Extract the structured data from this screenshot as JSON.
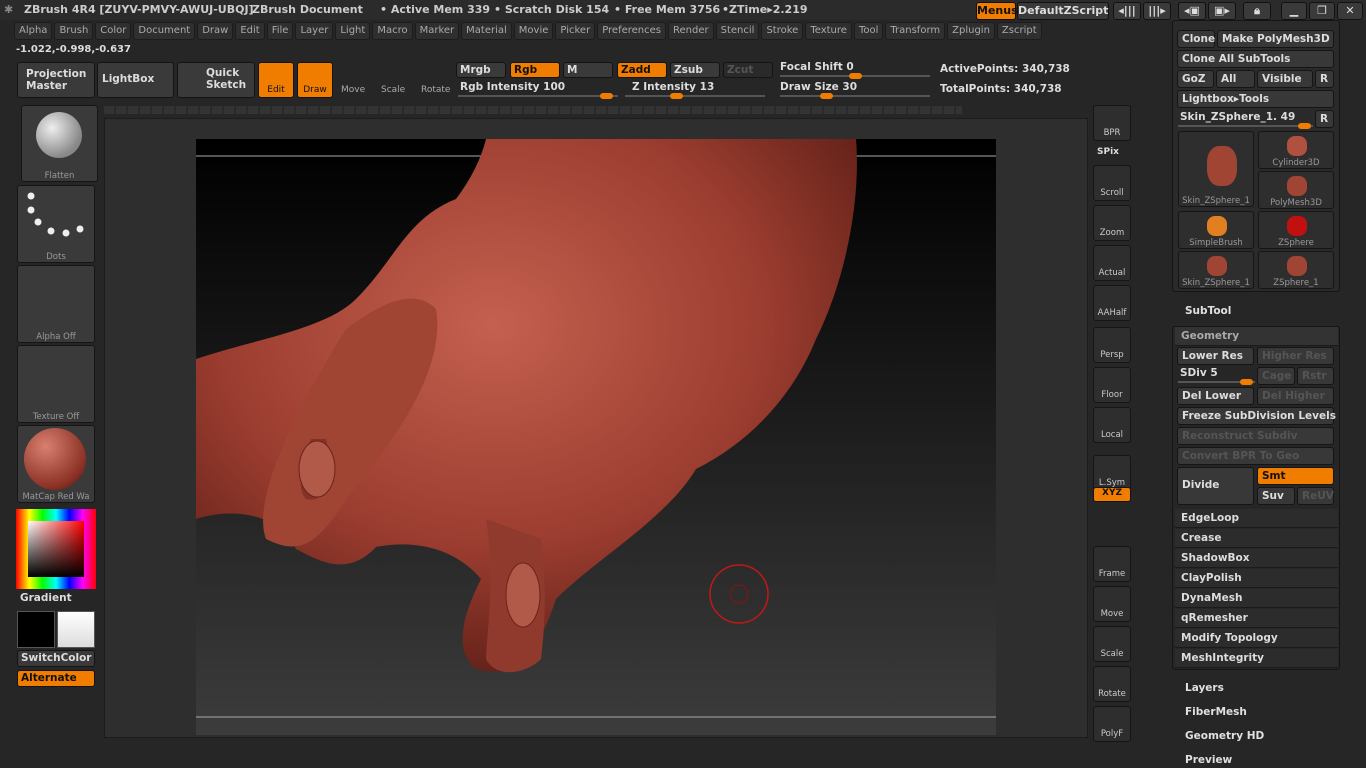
{
  "title": {
    "app": "ZBrush 4R4 [ZUYV-PMVY-AWUJ-UBQJ]",
    "doc": "ZBrush Document",
    "active_mem": "• Active Mem 339",
    "scratch": "• Scratch Disk 154",
    "free_mem": "• Free Mem 3756",
    "ztime": "•ZTime▸2.219",
    "menus": "Menus",
    "defaultzscript": "DefaultZScript"
  },
  "menu": [
    "Alpha",
    "Brush",
    "Color",
    "Document",
    "Draw",
    "Edit",
    "File",
    "Layer",
    "Light",
    "Macro",
    "Marker",
    "Material",
    "Movie",
    "Picker",
    "Preferences",
    "Render",
    "Stencil",
    "Stroke",
    "Texture",
    "Tool",
    "Transform",
    "Zplugin",
    "Zscript"
  ],
  "coords": "-1.022,-0.998,-0.637",
  "toolbar": {
    "projection_master": "Projection Master",
    "lightbox": "LightBox",
    "quick_sketch": "Quick Sketch",
    "edit": "Edit",
    "draw": "Draw",
    "move": "Move",
    "scale": "Scale",
    "rotate": "Rotate",
    "mrgb": "Mrgb",
    "rgb": "Rgb",
    "m": "M",
    "zadd": "Zadd",
    "zsub": "Zsub",
    "zcut": "Zcut",
    "rgb_intensity": "Rgb Intensity 100",
    "z_intensity": "Z Intensity 13",
    "focal_shift": "Focal Shift 0",
    "draw_size": "Draw Size 30",
    "active_points": "ActivePoints: 340,738",
    "total_points": "TotalPoints: 340,738",
    "rgb_intensity_value": 100,
    "z_intensity_value": 13,
    "focal_shift_value": 0,
    "draw_size_value": 30
  },
  "left_shelf": {
    "brush": "Flatten",
    "stroke": "Dots",
    "alpha": "Alpha Off",
    "texture": "Texture Off",
    "material": "MatCap Red Wa",
    "gradient": "Gradient",
    "switchcolor": "SwitchColor",
    "alternate": "Alternate"
  },
  "right_shelf": [
    "BPR",
    "SPix",
    "Scroll",
    "Zoom",
    "Actual",
    "AAHalf",
    "Persp",
    "Floor",
    "Local",
    "L.Sym",
    "XYZ",
    "Frame",
    "Move",
    "Scale",
    "Rotate",
    "PolyF"
  ],
  "tool_panel": {
    "clone": "Clone",
    "make_polymesh": "Make PolyMesh3D",
    "clone_all": "Clone All SubTools",
    "goz": "GoZ",
    "all": "All",
    "visible": "Visible",
    "r": "R",
    "lightbox_tools": "Lightbox▸Tools",
    "current_tool": "Skin_ZSphere_1. 49",
    "tools": [
      "Skin_ZSphere_1",
      "Cylinder3D",
      "PolyMesh3D",
      "SimpleBrush",
      "ZSphere",
      "Skin_ZSphere_1",
      "ZSphere_1"
    ],
    "subtool": "SubTool",
    "geometry": "Geometry",
    "lower_res": "Lower Res",
    "higher_res": "Higher Res",
    "sdiv": "SDiv 5",
    "cage": "Cage",
    "rstr": "Rstr",
    "del_lower": "Del Lower",
    "del_higher": "Del Higher",
    "freeze": "Freeze SubDivision Levels",
    "reconstruct": "Reconstruct Subdiv",
    "convert_bpr": "Convert BPR To Geo",
    "divide": "Divide",
    "smt": "Smt",
    "suv": "Suv",
    "reuv": "ReUV",
    "subsections": [
      "EdgeLoop",
      "Crease",
      "ShadowBox",
      "ClayPolish",
      "DynaMesh",
      "qRemesher",
      "Modify Topology",
      "MeshIntegrity"
    ],
    "sections": [
      "Layers",
      "FiberMesh",
      "Geometry HD",
      "Preview"
    ]
  },
  "colors": {
    "accent": "#f07c00",
    "bg": "#262626",
    "clay": "#a5483a"
  }
}
